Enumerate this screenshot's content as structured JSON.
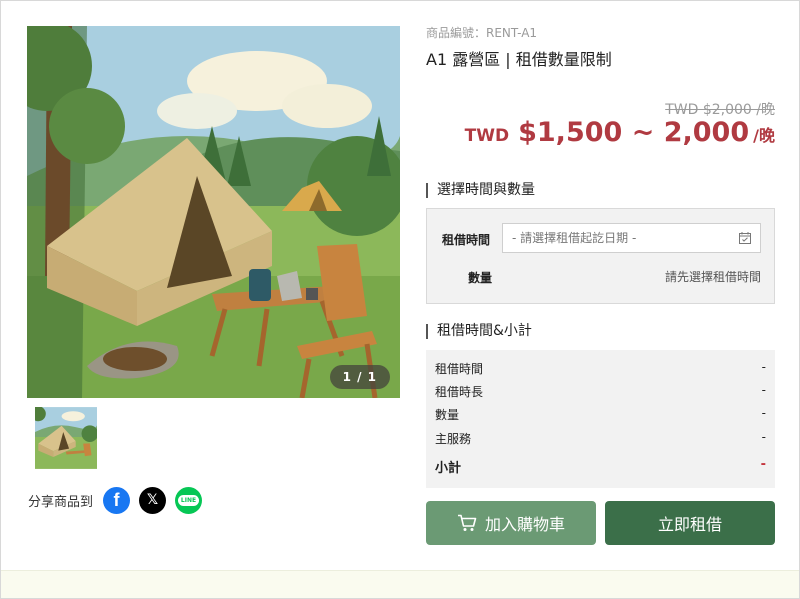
{
  "product": {
    "sku": "商品編號：RENT-A1",
    "title": "A1 露營區 | 租借數量限制",
    "original_price": "TWD $2,000 /晚",
    "price_currency": "TWD",
    "price_value": "$1,500 ~ 2,000",
    "price_unit": "/晚",
    "accent_color": "#b03a41"
  },
  "gallery": {
    "counter": "1 / 1",
    "hero_image": "camping-tent-illustration",
    "thumbnail": "camping-tent-illustration"
  },
  "share": {
    "label": "分享商品到",
    "icons": [
      "facebook-icon",
      "x-icon",
      "line-icon"
    ],
    "facebook_glyph": "f",
    "x_glyph": "𝕏",
    "line_glyph": "LINE"
  },
  "selection": {
    "section_title": "選擇時間與數量",
    "date_label": "租借時間",
    "date_placeholder": "- 請選擇租借起訖日期 -",
    "qty_label": "數量",
    "qty_note": "請先選擇租借時間"
  },
  "summary": {
    "section_title": "租借時間&小計",
    "rows": [
      {
        "label": "租借時間",
        "value": "-"
      },
      {
        "label": "租借時長",
        "value": "-"
      },
      {
        "label": "數量",
        "value": "-"
      },
      {
        "label": "主服務",
        "value": "-"
      }
    ],
    "total_label": "小計",
    "total_value": "-"
  },
  "actions": {
    "add_to_cart": "加入購物車",
    "rent_now": "立即租借"
  }
}
